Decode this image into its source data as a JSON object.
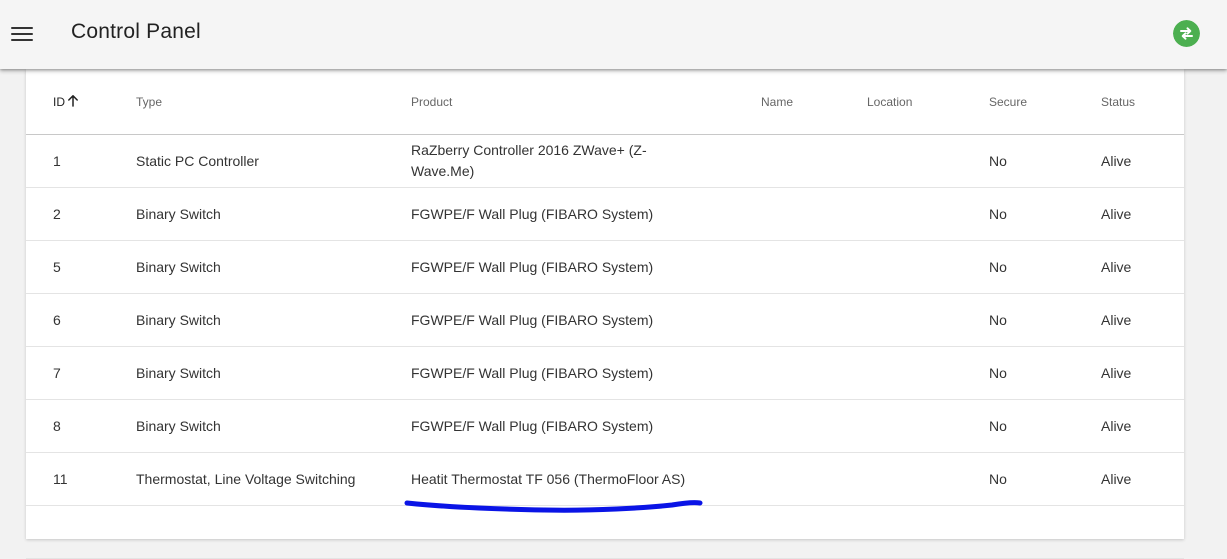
{
  "appbar": {
    "title": "Control Panel",
    "menu_icon": "menu-icon",
    "sync_icon": "swap-arrows-icon",
    "sync_color": "#4caf50"
  },
  "table": {
    "columns": [
      {
        "label": "ID",
        "sorted": "ascending"
      },
      {
        "label": "Type"
      },
      {
        "label": "Product"
      },
      {
        "label": "Name"
      },
      {
        "label": "Location"
      },
      {
        "label": "Secure"
      },
      {
        "label": "Status"
      }
    ],
    "rows": [
      {
        "id": "1",
        "type": "Static PC Controller",
        "product": "RaZberry Controller 2016 ZWave+ (Z-Wave.Me)",
        "name": "",
        "location": "",
        "secure": "No",
        "status": "Alive"
      },
      {
        "id": "2",
        "type": "Binary Switch",
        "product": "FGWPE/F Wall Plug (FIBARO System)",
        "name": "",
        "location": "",
        "secure": "No",
        "status": "Alive"
      },
      {
        "id": "5",
        "type": "Binary Switch",
        "product": "FGWPE/F Wall Plug (FIBARO System)",
        "name": "",
        "location": "",
        "secure": "No",
        "status": "Alive"
      },
      {
        "id": "6",
        "type": "Binary Switch",
        "product": "FGWPE/F Wall Plug (FIBARO System)",
        "name": "",
        "location": "",
        "secure": "No",
        "status": "Alive"
      },
      {
        "id": "7",
        "type": "Binary Switch",
        "product": "FGWPE/F Wall Plug (FIBARO System)",
        "name": "",
        "location": "",
        "secure": "No",
        "status": "Alive"
      },
      {
        "id": "8",
        "type": "Binary Switch",
        "product": "FGWPE/F Wall Plug (FIBARO System)",
        "name": "",
        "location": "",
        "secure": "No",
        "status": "Alive"
      },
      {
        "id": "11",
        "type": "Thermostat, Line Voltage Switching",
        "product": "Heatit Thermostat TF 056 (ThermoFloor AS)",
        "name": "",
        "location": "",
        "secure": "No",
        "status": "Alive"
      }
    ]
  },
  "annotation": {
    "color": "#0a14e6"
  }
}
